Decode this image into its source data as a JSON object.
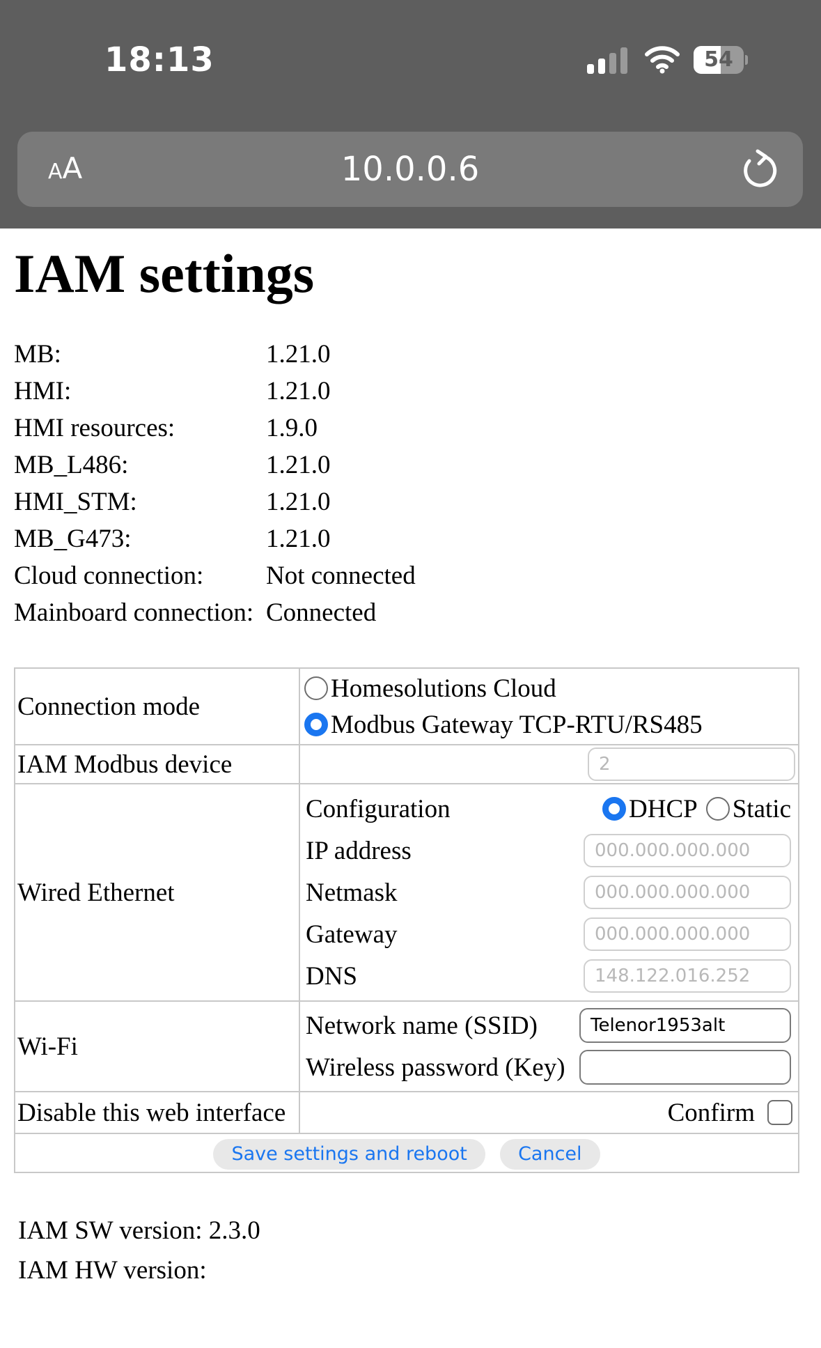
{
  "status_bar": {
    "time": "18:13",
    "battery_percent": "54",
    "battery_level": 0.54,
    "signal_bars_active": 2,
    "signal_bars_total": 4
  },
  "browser": {
    "text_size_label_small": "A",
    "text_size_label_big": "A",
    "url": "10.0.0.6",
    "icons": [
      "cellular-signal-icon",
      "wifi-icon",
      "battery-icon",
      "reload-icon"
    ]
  },
  "page": {
    "title": "IAM settings",
    "info": [
      {
        "key": "MB:",
        "value": "1.21.0"
      },
      {
        "key": "HMI:",
        "value": "1.21.0"
      },
      {
        "key": "HMI resources:",
        "value": "1.9.0"
      },
      {
        "key": "MB_L486:",
        "value": "1.21.0"
      },
      {
        "key": "HMI_STM:",
        "value": "1.21.0"
      },
      {
        "key": "MB_G473:",
        "value": "1.21.0"
      },
      {
        "key": "Cloud connection:",
        "value": "Not connected"
      },
      {
        "key": "Mainboard connection:",
        "value": "Connected"
      }
    ],
    "connection_mode": {
      "label": "Connection mode",
      "options": [
        "Homesolutions Cloud",
        "Modbus Gateway TCP-RTU/RS485"
      ],
      "selected": "Modbus Gateway TCP-RTU/RS485"
    },
    "modbus_device": {
      "label": "IAM Modbus device",
      "value": "2"
    },
    "wired": {
      "label": "Wired Ethernet",
      "configuration_label": "Configuration",
      "dhcp_label": "DHCP",
      "static_label": "Static",
      "selected": "DHCP",
      "ip_label": "IP address",
      "ip_placeholder": "000.000.000.000",
      "netmask_label": "Netmask",
      "netmask_placeholder": "000.000.000.000",
      "gateway_label": "Gateway",
      "gateway_placeholder": "000.000.000.000",
      "dns_label": "DNS",
      "dns_value": "148.122.016.252"
    },
    "wifi": {
      "label": "Wi-Fi",
      "ssid_label": "Network name (SSID)",
      "ssid_value": "Telenor1953alt",
      "key_label": "Wireless password (Key)",
      "key_value": ""
    },
    "disable": {
      "label": "Disable this web interface",
      "confirm_label": "Confirm",
      "confirmed": false
    },
    "buttons": {
      "save": "Save settings and reboot",
      "cancel": "Cancel"
    },
    "footer": {
      "sw_version": "IAM SW version: 2.3.0",
      "hw_version": "IAM HW version:"
    }
  }
}
